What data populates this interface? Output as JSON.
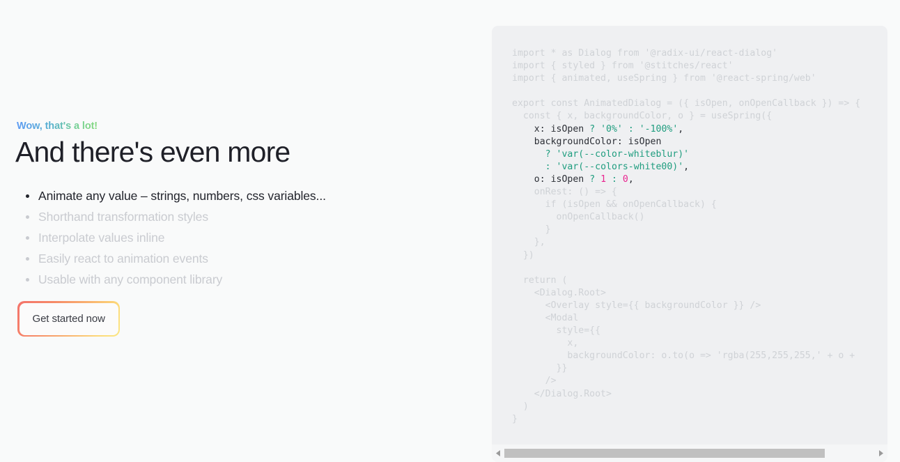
{
  "left": {
    "eyebrow": "Wow, that's a lot!",
    "headline": "And there's even more",
    "features": [
      {
        "label": "Animate any value – strings, numbers, css variables...",
        "active": true
      },
      {
        "label": "Shorthand transformation styles",
        "active": false
      },
      {
        "label": "Interpolate values inline",
        "active": false
      },
      {
        "label": "Easily react to animation events",
        "active": false
      },
      {
        "label": "Usable with any component library",
        "active": false
      }
    ],
    "cta_label": "Get started now"
  },
  "code_panel": {
    "lines": [
      [
        {
          "t": "import * as Dialog from '@radix-ui/react-dialog'",
          "c": "dim"
        }
      ],
      [
        {
          "t": "import { styled } from '@stitches/react'",
          "c": "dim"
        }
      ],
      [
        {
          "t": "import { animated, useSpring } from '@react-spring/web'",
          "c": "dim"
        }
      ],
      [
        {
          "t": "",
          "c": "dim"
        }
      ],
      [
        {
          "t": "export const AnimatedDialog = ({ isOpen, onOpenCallback }) => {",
          "c": "dim"
        }
      ],
      [
        {
          "t": "  const { x, backgroundColor, o } = useSpring({",
          "c": "dim"
        }
      ],
      [
        {
          "t": "    x",
          "c": "plain"
        },
        {
          "t": ":",
          "c": "plain"
        },
        {
          "t": " isOpen ",
          "c": "plain"
        },
        {
          "t": "?",
          "c": "op"
        },
        {
          "t": " ",
          "c": "plain"
        },
        {
          "t": "'0%'",
          "c": "str"
        },
        {
          "t": " ",
          "c": "plain"
        },
        {
          "t": ":",
          "c": "op"
        },
        {
          "t": " ",
          "c": "plain"
        },
        {
          "t": "'-100%'",
          "c": "str"
        },
        {
          "t": ",",
          "c": "plain"
        }
      ],
      [
        {
          "t": "    backgroundColor",
          "c": "plain"
        },
        {
          "t": ":",
          "c": "plain"
        },
        {
          "t": " isOpen",
          "c": "plain"
        }
      ],
      [
        {
          "t": "      ",
          "c": "plain"
        },
        {
          "t": "?",
          "c": "op"
        },
        {
          "t": " ",
          "c": "plain"
        },
        {
          "t": "'var(--color-whiteblur)'",
          "c": "str"
        }
      ],
      [
        {
          "t": "      ",
          "c": "plain"
        },
        {
          "t": ":",
          "c": "op"
        },
        {
          "t": " ",
          "c": "plain"
        },
        {
          "t": "'var(--colors-white00)'",
          "c": "str"
        },
        {
          "t": ",",
          "c": "plain"
        }
      ],
      [
        {
          "t": "    o",
          "c": "plain"
        },
        {
          "t": ":",
          "c": "plain"
        },
        {
          "t": " isOpen ",
          "c": "plain"
        },
        {
          "t": "?",
          "c": "op"
        },
        {
          "t": " ",
          "c": "plain"
        },
        {
          "t": "1",
          "c": "num"
        },
        {
          "t": " ",
          "c": "plain"
        },
        {
          "t": ":",
          "c": "op"
        },
        {
          "t": " ",
          "c": "plain"
        },
        {
          "t": "0",
          "c": "num"
        },
        {
          "t": ",",
          "c": "plain"
        }
      ],
      [
        {
          "t": "    onRest: () => {",
          "c": "dim"
        }
      ],
      [
        {
          "t": "      if (isOpen && onOpenCallback) {",
          "c": "dim"
        }
      ],
      [
        {
          "t": "        onOpenCallback()",
          "c": "dim"
        }
      ],
      [
        {
          "t": "      }",
          "c": "dim"
        }
      ],
      [
        {
          "t": "    },",
          "c": "dim"
        }
      ],
      [
        {
          "t": "  })",
          "c": "dim"
        }
      ],
      [
        {
          "t": "",
          "c": "dim"
        }
      ],
      [
        {
          "t": "  return (",
          "c": "dim"
        }
      ],
      [
        {
          "t": "    <Dialog.Root>",
          "c": "dim"
        }
      ],
      [
        {
          "t": "      <Overlay style={{ backgroundColor }} />",
          "c": "dim"
        }
      ],
      [
        {
          "t": "      <Modal",
          "c": "dim"
        }
      ],
      [
        {
          "t": "        style={{",
          "c": "dim"
        }
      ],
      [
        {
          "t": "          x,",
          "c": "dim"
        }
      ],
      [
        {
          "t": "          backgroundColor: o.to(o => 'rgba(255,255,255,' + o +",
          "c": "dim"
        }
      ],
      [
        {
          "t": "        }}",
          "c": "dim"
        }
      ],
      [
        {
          "t": "      />",
          "c": "dim"
        }
      ],
      [
        {
          "t": "    </Dialog.Root>",
          "c": "dim"
        }
      ],
      [
        {
          "t": "  )",
          "c": "dim"
        }
      ],
      [
        {
          "t": "}",
          "c": "dim"
        }
      ]
    ],
    "scrollbar": {
      "left_arrow": "scroll-left",
      "right_arrow": "scroll-right",
      "thumb_width_pct": 86.5
    }
  },
  "colors": {
    "page_background": "#f9fafa",
    "panel_background": "#eff0f2",
    "heading": "#1f2028",
    "muted_text": "#c9cbd0",
    "active_text": "#22242c",
    "eyebrow_gradient_start": "#5e9bf4",
    "eyebrow_gradient_end": "#86d97f",
    "cta_gradient_start": "#f4736b",
    "cta_gradient_end": "#fbe784",
    "code_dim": "#cfd2d6",
    "code_plain": "#2c2f36",
    "code_string": "#1f9d7f",
    "code_number": "#e9238f",
    "scrollbar_thumb": "#c0c0c0"
  }
}
